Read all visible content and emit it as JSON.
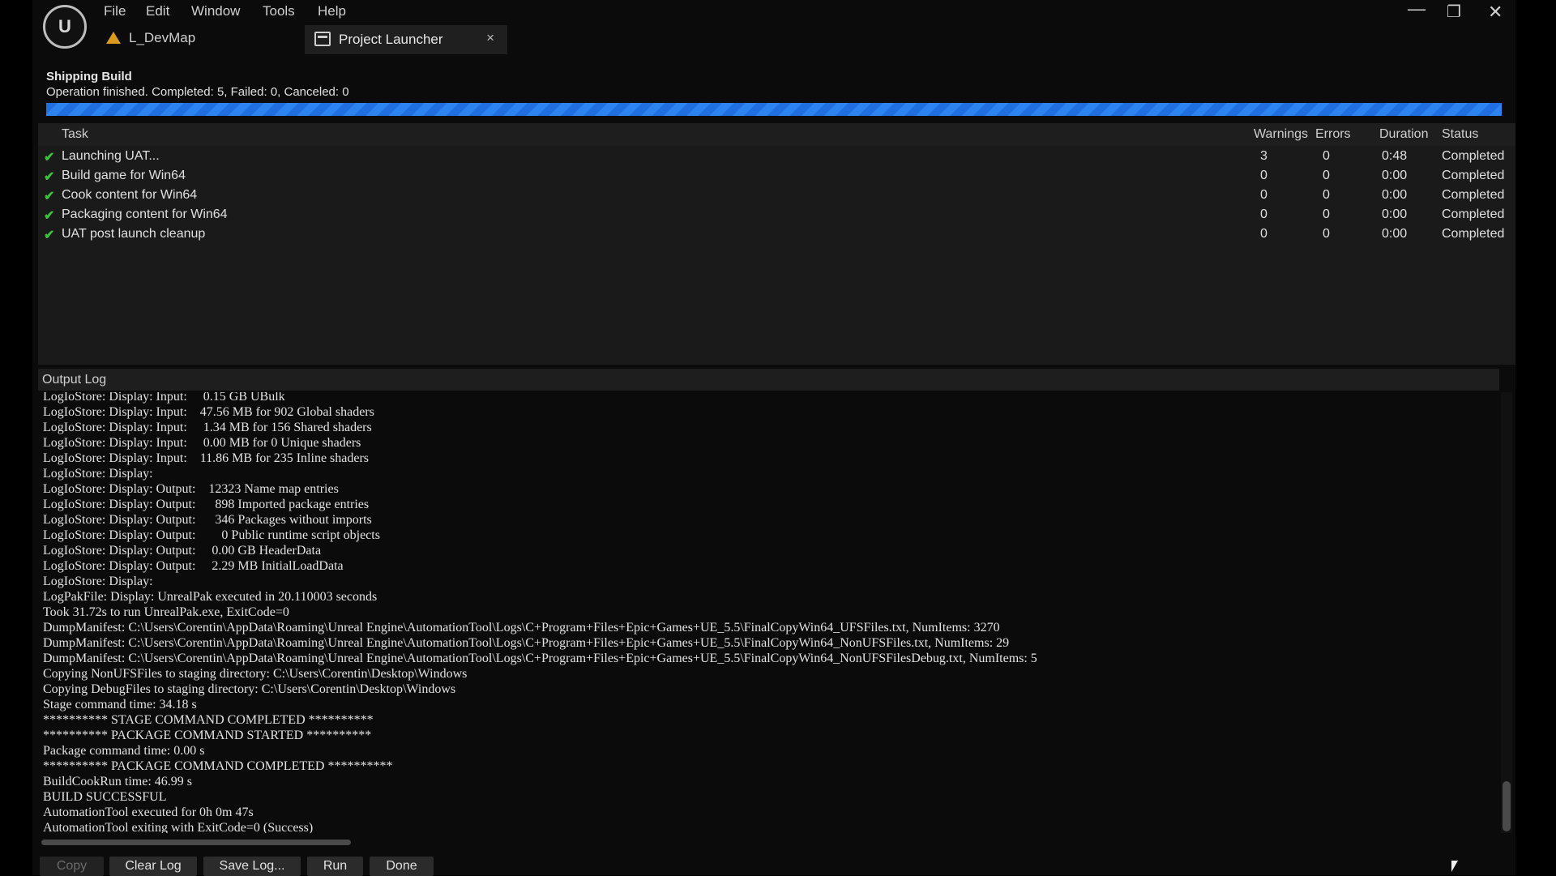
{
  "menu": {
    "items": [
      "File",
      "Edit",
      "Window",
      "Tools",
      "Help"
    ]
  },
  "tabs": {
    "map_tab": "L_DevMap",
    "project_tab": "Project Launcher",
    "close_glyph": "×"
  },
  "window_controls": {
    "minimize": "—",
    "maximize": "❐",
    "close": "✕"
  },
  "build": {
    "title": "Shipping Build",
    "status": "Operation finished. Completed: 5, Failed: 0, Canceled: 0",
    "progress": 1.0
  },
  "task_table": {
    "columns": [
      "Task",
      "Warnings",
      "Errors",
      "Duration",
      "Status"
    ],
    "rows": [
      {
        "task": "Launching UAT...",
        "warnings": "3",
        "errors": "0",
        "duration": "0:48",
        "status": "Completed"
      },
      {
        "task": "Build game for Win64",
        "warnings": "0",
        "errors": "0",
        "duration": "0:00",
        "status": "Completed"
      },
      {
        "task": "Cook content for Win64",
        "warnings": "0",
        "errors": "0",
        "duration": "0:00",
        "status": "Completed"
      },
      {
        "task": "Packaging content for Win64",
        "warnings": "0",
        "errors": "0",
        "duration": "0:00",
        "status": "Completed"
      },
      {
        "task": "UAT post launch cleanup",
        "warnings": "0",
        "errors": "0",
        "duration": "0:00",
        "status": "Completed"
      }
    ]
  },
  "output_log": {
    "title": "Output Log",
    "lines": [
      "LogIoStore: Display: Input:     0.15 GB UBulk",
      "LogIoStore: Display: Input:    47.56 MB for 902 Global shaders",
      "LogIoStore: Display: Input:     1.34 MB for 156 Shared shaders",
      "LogIoStore: Display: Input:     0.00 MB for 0 Unique shaders",
      "LogIoStore: Display: Input:    11.86 MB for 235 Inline shaders",
      "LogIoStore: Display:",
      "LogIoStore: Display: Output:    12323 Name map entries",
      "LogIoStore: Display: Output:      898 Imported package entries",
      "LogIoStore: Display: Output:      346 Packages without imports",
      "LogIoStore: Display: Output:        0 Public runtime script objects",
      "LogIoStore: Display: Output:     0.00 GB HeaderData",
      "LogIoStore: Display: Output:     2.29 MB InitialLoadData",
      "LogIoStore: Display:",
      "LogPakFile: Display: UnrealPak executed in 20.110003 seconds",
      "Took 31.72s to run UnrealPak.exe, ExitCode=0",
      "DumpManifest: C:\\Users\\Corentin\\AppData\\Roaming\\Unreal Engine\\AutomationTool\\Logs\\C+Program+Files+Epic+Games+UE_5.5\\FinalCopyWin64_UFSFiles.txt, NumItems: 3270",
      "DumpManifest: C:\\Users\\Corentin\\AppData\\Roaming\\Unreal Engine\\AutomationTool\\Logs\\C+Program+Files+Epic+Games+UE_5.5\\FinalCopyWin64_NonUFSFiles.txt, NumItems: 29",
      "DumpManifest: C:\\Users\\Corentin\\AppData\\Roaming\\Unreal Engine\\AutomationTool\\Logs\\C+Program+Files+Epic+Games+UE_5.5\\FinalCopyWin64_NonUFSFilesDebug.txt, NumItems: 5",
      "Copying NonUFSFiles to staging directory: C:\\Users\\Corentin\\Desktop\\Windows",
      "Copying DebugFiles to staging directory: C:\\Users\\Corentin\\Desktop\\Windows",
      "Stage command time: 34.18 s",
      "********** STAGE COMMAND COMPLETED **********",
      "********** PACKAGE COMMAND STARTED **********",
      "Package command time: 0.00 s",
      "********** PACKAGE COMMAND COMPLETED **********",
      "BuildCookRun time: 46.99 s",
      "BUILD SUCCESSFUL",
      "AutomationTool executed for 0h 0m 47s",
      "AutomationTool exiting with ExitCode=0 (Success)"
    ]
  },
  "buttons": {
    "copy": "Copy",
    "clear_log": "Clear Log",
    "save_log": "Save Log...",
    "run": "Run",
    "done": "Done"
  }
}
